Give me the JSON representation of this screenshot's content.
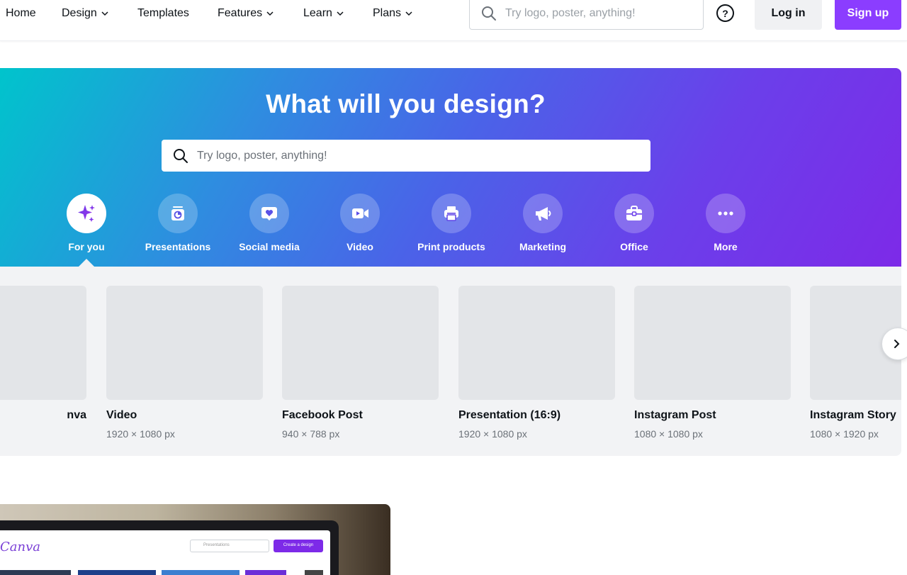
{
  "nav": {
    "items": [
      {
        "label": "Home",
        "dropdown": false
      },
      {
        "label": "Design",
        "dropdown": true
      },
      {
        "label": "Templates",
        "dropdown": false
      },
      {
        "label": "Features",
        "dropdown": true
      },
      {
        "label": "Learn",
        "dropdown": true
      },
      {
        "label": "Plans",
        "dropdown": true
      }
    ],
    "search_placeholder": "Try logo, poster, anything!",
    "help_icon": "question-circle-icon",
    "login_label": "Log in",
    "signup_label": "Sign up",
    "brand_color": "#8b3dff"
  },
  "hero": {
    "title": "What will you design?",
    "search_placeholder": "Try logo, poster, anything!",
    "categories": [
      {
        "label": "For you",
        "icon": "sparkle-icon",
        "active": true
      },
      {
        "label": "Presentations",
        "icon": "presentation-icon",
        "active": false
      },
      {
        "label": "Social media",
        "icon": "heart-chat-icon",
        "active": false
      },
      {
        "label": "Video",
        "icon": "video-camera-icon",
        "active": false
      },
      {
        "label": "Print products",
        "icon": "printer-icon",
        "active": false
      },
      {
        "label": "Marketing",
        "icon": "megaphone-icon",
        "active": false
      },
      {
        "label": "Office",
        "icon": "briefcase-icon",
        "active": false
      },
      {
        "label": "More",
        "icon": "more-dots-icon",
        "active": false
      }
    ]
  },
  "templates": {
    "cards": [
      {
        "name": "nva",
        "dims": ""
      },
      {
        "name": "Video",
        "dims": "1920 × 1080 px"
      },
      {
        "name": "Facebook Post",
        "dims": "940 × 788 px"
      },
      {
        "name": "Presentation (16:9)",
        "dims": "1920 × 1080 px"
      },
      {
        "name": "Instagram Post",
        "dims": "1080 × 1080 px"
      },
      {
        "name": "Instagram Story",
        "dims": "1080 × 1920 px"
      }
    ],
    "next_icon": "chevron-right-icon"
  },
  "promo": {
    "logo_text": "Canva",
    "search_placeholder": "Presentations",
    "button_label": "Create a design"
  }
}
